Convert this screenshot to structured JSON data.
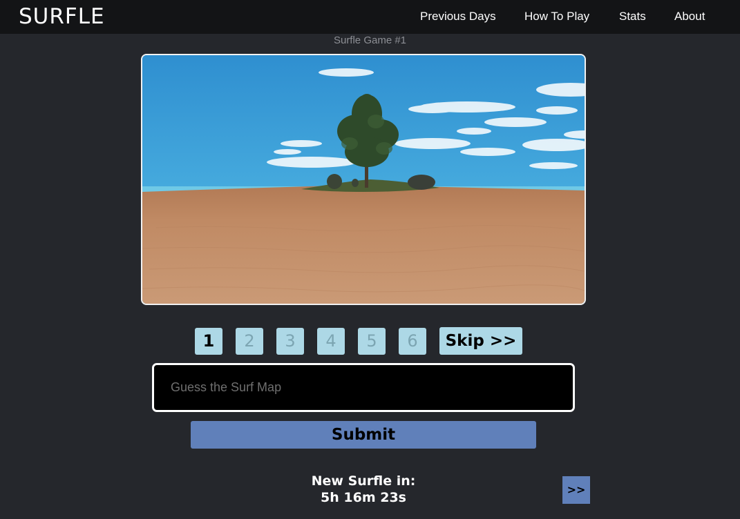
{
  "app": {
    "logo": "SURFLE"
  },
  "nav": {
    "items": [
      {
        "label": "Previous Days"
      },
      {
        "label": "How To Play"
      },
      {
        "label": "Stats"
      },
      {
        "label": "About"
      }
    ]
  },
  "game": {
    "title": "Surfle Game #1",
    "clip_icon": "surf-map-screenshot",
    "attempts": [
      "1",
      "2",
      "3",
      "4",
      "5",
      "6"
    ],
    "active_attempt": "1",
    "skip_label": "Skip >>",
    "guess_placeholder": "Guess the Surf Map",
    "guess_value": "",
    "submit_label": "Submit"
  },
  "footer": {
    "countdown_label": "New Surfle in:",
    "countdown_value": "5h 16m 23s",
    "next_label": ">>"
  },
  "colors": {
    "navbar_bg": "#131416",
    "page_bg": "#25272c",
    "attempt_bg": "#add8e6",
    "submit_bg": "#6080ba"
  }
}
